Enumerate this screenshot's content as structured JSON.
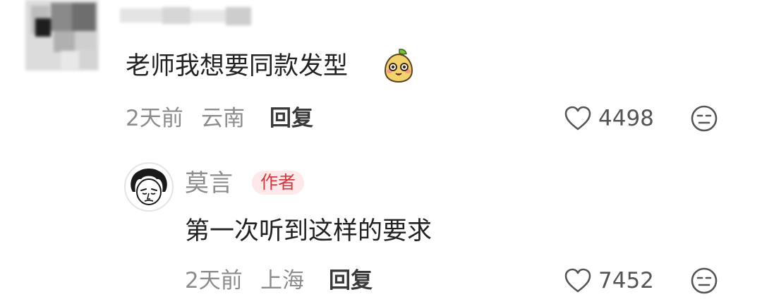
{
  "comment": {
    "text": "老师我想要同款发型",
    "emoji_icon": "sticker-pear-face-icon",
    "time": "2天前",
    "location": "云南",
    "reply_label": "回复",
    "like_count": "4498"
  },
  "reply": {
    "author_name": "莫言",
    "author_badge": "作者",
    "text": "第一次听到这样的要求",
    "time": "2天前",
    "location": "上海",
    "reply_label": "回复",
    "like_count": "7452"
  },
  "colors": {
    "text": "#222222",
    "meta": "#8c8c8c",
    "badge_bg": "#fde8ea",
    "badge_text": "#d9363e"
  }
}
